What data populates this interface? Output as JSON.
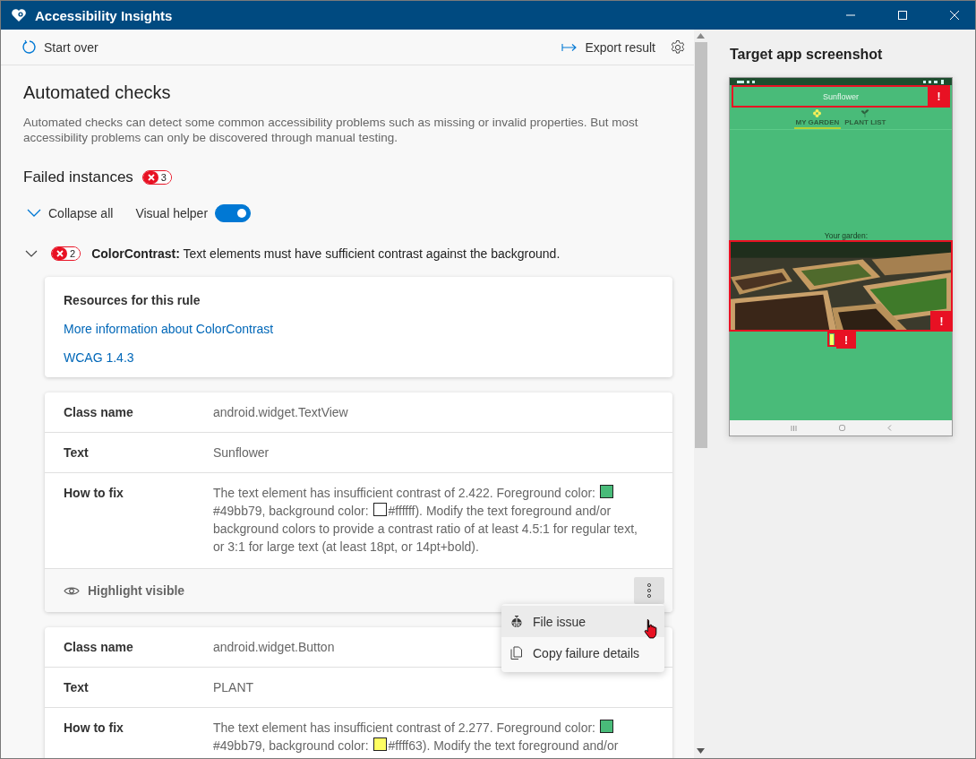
{
  "window": {
    "title": "Accessibility Insights"
  },
  "toolbar": {
    "start_over": "Start over",
    "export": "Export result"
  },
  "heading": "Automated checks",
  "description": "Automated checks can detect some common accessibility problems such as missing or invalid properties. But most accessibility problems can only be discovered through manual testing.",
  "failed": {
    "label": "Failed instances",
    "count": "3"
  },
  "collapse_all": "Collapse all",
  "visual_helper": {
    "label": "Visual helper",
    "on": true
  },
  "rules": [
    {
      "expanded": true,
      "count": "2",
      "title": "**ColorContrast:** Text elements must have sufficient contrast against the background.",
      "resources": {
        "title": "Resources for this rule",
        "links": [
          "More information about ColorContrast",
          "WCAG 1.4.3"
        ]
      },
      "instances": [
        {
          "rows": [
            {
              "label": "Class name",
              "value": "android.widget.TextView"
            },
            {
              "label": "Text",
              "value": "Sunflower"
            }
          ],
          "how_to_fix": {
            "label": "How to fix",
            "parts": [
              "The text element has insufficient contrast of 2.422. Foreground color:",
              "#49bb79, background color:",
              "#ffffff). Modify the text foreground and/or background colors to provide a contrast ratio of at least 4.5:1 for regular text, or 3:1 for large text (at least 18pt, or 14pt+bold)."
            ],
            "swatches": [
              {
                "color": "#49bb79"
              },
              {
                "color": "#ffffff"
              }
            ]
          },
          "footer": {
            "highlight": "Highlight visible",
            "menu_open": true
          }
        },
        {
          "rows": [
            {
              "label": "Class name",
              "value": "android.widget.Button"
            },
            {
              "label": "Text",
              "value": "PLANT"
            }
          ],
          "how_to_fix": {
            "label": "How to fix",
            "parts": [
              "The text element has insufficient contrast of 2.277. Foreground color:",
              "#49bb79, background color:",
              "#ffff63). Modify the text foreground and/or"
            ],
            "swatches": [
              {
                "color": "#49bb79"
              },
              {
                "color": "#ffff63"
              }
            ]
          }
        }
      ]
    }
  ],
  "context_menu": {
    "items": [
      {
        "kind": "bug",
        "label": "File issue",
        "hovered": true
      },
      {
        "kind": "copy",
        "label": "Copy failure details",
        "hovered": false
      }
    ]
  },
  "target": {
    "title": "Target app screenshot",
    "app": {
      "header": "Sunflower",
      "tabs": [
        {
          "label": "MY GARDEN",
          "selected": true
        },
        {
          "label": "PLANT LIST",
          "selected": false
        }
      ],
      "caption": "Your garden:",
      "failure_marks": [
        "!",
        "!",
        "!"
      ]
    }
  }
}
